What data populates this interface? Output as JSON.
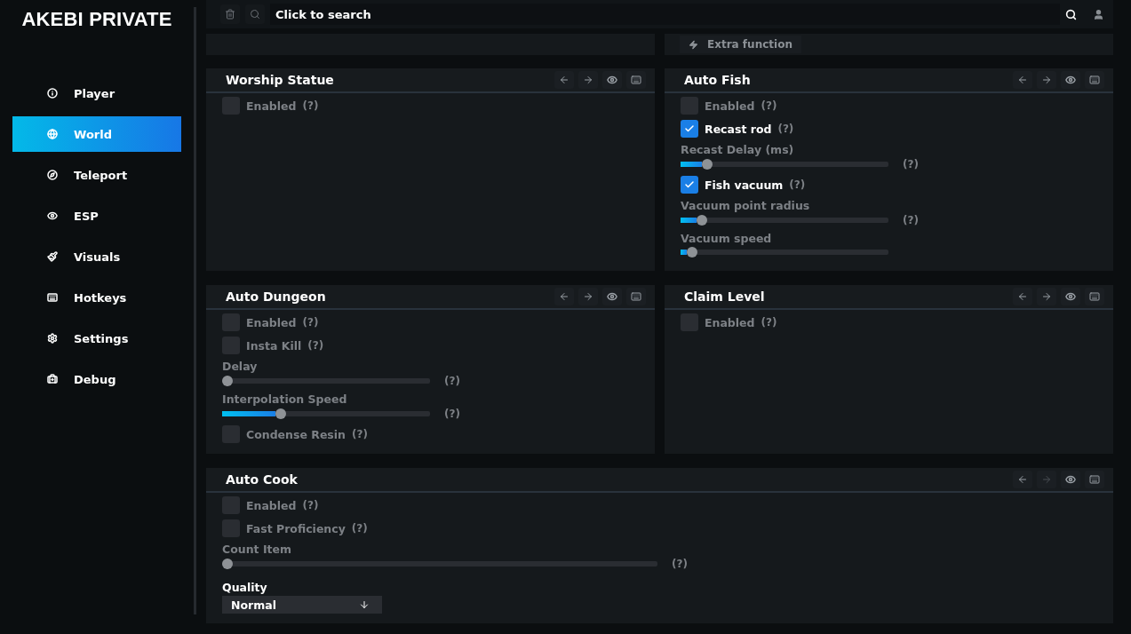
{
  "sidebar": {
    "title": "AKEBI PRIVATE",
    "items": [
      {
        "label": "Player",
        "selected": false
      },
      {
        "label": "World",
        "selected": true
      },
      {
        "label": "Teleport",
        "selected": false
      },
      {
        "label": "ESP",
        "selected": false
      },
      {
        "label": "Visuals",
        "selected": false
      },
      {
        "label": "Hotkeys",
        "selected": false
      },
      {
        "label": "Settings",
        "selected": false
      },
      {
        "label": "Debug",
        "selected": false
      }
    ]
  },
  "search": {
    "placeholder": "Click to search"
  },
  "extra_function": {
    "label": "Extra function"
  },
  "panels": [
    {
      "title": "Worship Statue",
      "next_disabled": false,
      "items": [
        {
          "kind": "checkbox",
          "label": "Enabled",
          "help": "(?)",
          "checked": false
        }
      ]
    },
    {
      "title": "Auto Fish",
      "next_disabled": false,
      "items": [
        {
          "kind": "checkbox",
          "label": "Enabled",
          "help": "(?)",
          "checked": false
        },
        {
          "kind": "checkbox",
          "label": "Recast rod",
          "help": "(?)",
          "checked": true
        },
        {
          "kind": "slider",
          "label": "Recast Delay (ms)",
          "help": "(?)",
          "level": 0.11
        },
        {
          "kind": "checkbox",
          "label": "Fish vacuum",
          "help": "(?)",
          "checked": true
        },
        {
          "kind": "slider",
          "label": "Vacuum point radius",
          "help": "(?)",
          "level": 0.08
        },
        {
          "kind": "slider",
          "label": "Vacuum speed",
          "level": 0.03
        }
      ]
    },
    {
      "title": "Auto Dungeon",
      "next_disabled": false,
      "items": [
        {
          "kind": "checkbox",
          "label": "Enabled",
          "help": "(?)",
          "checked": false
        },
        {
          "kind": "checkbox",
          "label": "Insta Kill",
          "help": "(?)",
          "checked": false
        },
        {
          "kind": "slider",
          "label": "Delay",
          "help": "(?)",
          "level": 0
        },
        {
          "kind": "slider",
          "label": "Interpolation Speed",
          "help": "(?)",
          "level": 0.27
        },
        {
          "kind": "checkbox",
          "label": "Condense Resin",
          "help": "(?)",
          "checked": false
        }
      ]
    },
    {
      "title": "Claim Level",
      "next_disabled": false,
      "items": [
        {
          "kind": "checkbox",
          "label": "Enabled",
          "help": "(?)",
          "checked": false
        }
      ]
    },
    {
      "title": "Auto Cook",
      "next_disabled": true,
      "items": [
        {
          "kind": "checkbox",
          "label": "Enabled",
          "help": "(?)",
          "checked": false
        },
        {
          "kind": "checkbox",
          "label": "Fast Proficiency",
          "help": "(?)",
          "checked": false
        },
        {
          "kind": "slider",
          "label": "Count Item",
          "help": "(?)",
          "level": 0
        },
        {
          "kind": "combo",
          "label": "Quality",
          "value": "Normal"
        }
      ]
    }
  ]
}
